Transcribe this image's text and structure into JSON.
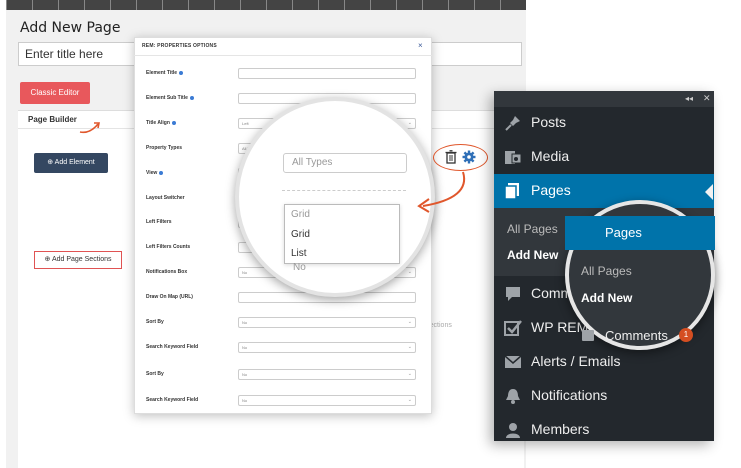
{
  "editor": {
    "page_title": "Add New Page",
    "title_placeholder": "Enter title here",
    "classic_editor_label": "Classic Editor",
    "page_builder_label": "Page Builder",
    "add_element_label": "Add Element",
    "add_sections_label": "Add Page Sections",
    "sections_faint": "Sections"
  },
  "modal": {
    "title": "REM: PROPERTIES OPTIONS",
    "close": "×",
    "rows": [
      {
        "label": "Element Title",
        "info": true,
        "value": ""
      },
      {
        "label": "Element Sub Title",
        "info": true,
        "value": ""
      },
      {
        "label": "Title Align",
        "info": true,
        "value": "Left"
      },
      {
        "label": "Property Types",
        "info": false,
        "value": "All Types"
      },
      {
        "label": "View",
        "info": true,
        "value": "Grid"
      },
      {
        "label": "Layout Switcher",
        "info": false,
        "value": ""
      },
      {
        "label": "Left Filters",
        "info": false,
        "value": ""
      },
      {
        "label": "Left Filters Counts",
        "info": false,
        "value": ""
      },
      {
        "label": "Notifications Box",
        "info": false,
        "value": "No"
      },
      {
        "label": "Draw On Map (URL)",
        "info": false,
        "value": ""
      },
      {
        "label": "Sort By",
        "info": false,
        "value": "No"
      },
      {
        "label": "Search Keyword Field",
        "info": false,
        "value": "No"
      },
      {
        "label": "Sort By",
        "info": false,
        "value": "No"
      },
      {
        "label": "Search Keyword Field",
        "info": false,
        "value": "No"
      }
    ]
  },
  "magnifier_fields": {
    "select_value": "All Types",
    "dropdown_options": [
      "Grid",
      "Grid",
      "List"
    ],
    "below_value": "No"
  },
  "wp_menu": {
    "items": [
      {
        "label": "Posts",
        "icon": "pin-icon"
      },
      {
        "label": "Media",
        "icon": "media-icon"
      },
      {
        "label": "Pages",
        "icon": "pages-icon",
        "active": true
      },
      {
        "label": "Comments",
        "icon": "comments-icon"
      },
      {
        "label": "WP REM",
        "icon": "check-icon"
      },
      {
        "label": "Alerts / Emails",
        "icon": "mail-icon"
      },
      {
        "label": "Notifications",
        "icon": "bell-icon"
      },
      {
        "label": "Members",
        "icon": "user-icon"
      }
    ],
    "submenu": [
      "All Pages",
      "Add New"
    ]
  },
  "magnifier_menu": {
    "pages": "Pages",
    "all_pages": "All Pages",
    "add_new": "Add New",
    "comments": "Comments",
    "badge": "1"
  },
  "colors": {
    "accent_red": "#e8585c",
    "wp_blue": "#0073aa",
    "wp_dark": "#23282d",
    "arrow_orange": "#e0572c",
    "button_navy": "#344761"
  }
}
